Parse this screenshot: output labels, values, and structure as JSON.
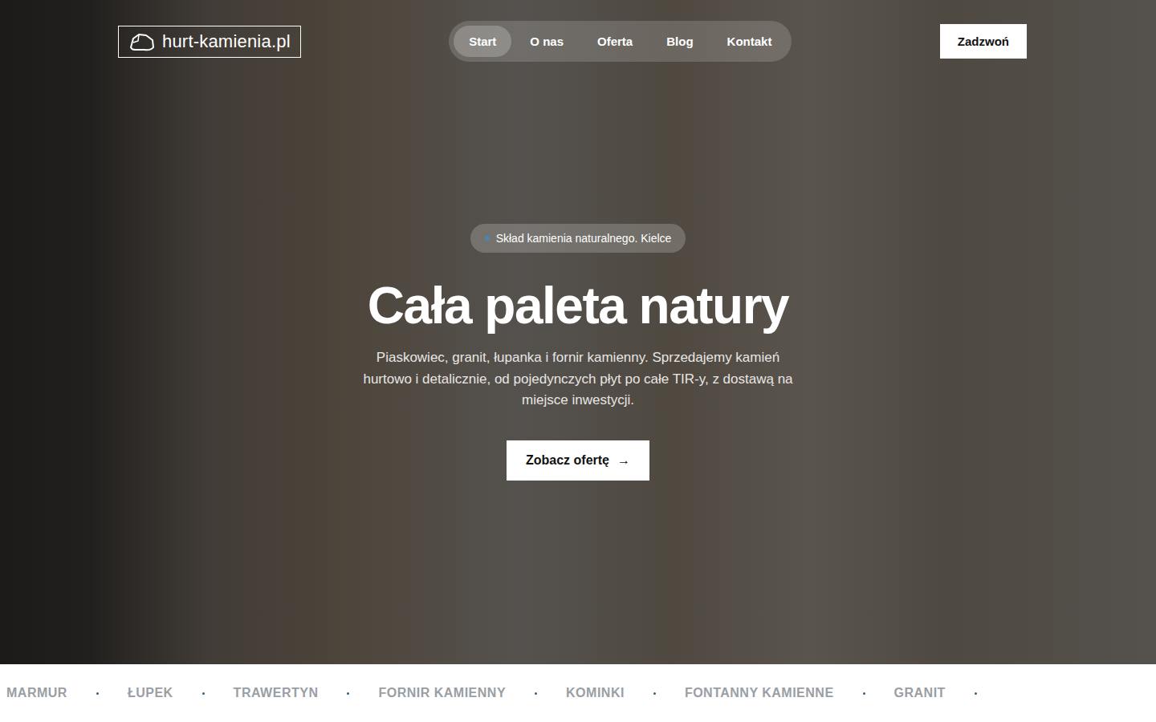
{
  "logo": {
    "text": "hurt-kamienia.pl"
  },
  "nav": [
    {
      "label": "Start",
      "selected": true
    },
    {
      "label": "O nas",
      "selected": false
    },
    {
      "label": "Oferta",
      "selected": false
    },
    {
      "label": "Blog",
      "selected": false
    },
    {
      "label": "Kontakt",
      "selected": false
    }
  ],
  "call_button": "Zadzwoń",
  "hero": {
    "badge": "Skład kamienia naturalnego. Kielce",
    "title": "Cała paleta natury",
    "description": "Piaskowiec, granit, łupanka i fornir kamienny. Sprzedajemy kamień hurtowo i detalicznie, od pojedynczych płyt po całe TIR-y, z dostawą na miejsce inwestycji.",
    "cta": {
      "label": "Zobacz ofertę",
      "icon": "→"
    }
  },
  "marquee": {
    "items": [
      "MARMUR",
      "ŁUPEK",
      "TRAWERTYN",
      "FORNIR KAMIENNY",
      "KOMINKI",
      "FONTANNY KAMIENNE",
      "GRANIT"
    ]
  }
}
